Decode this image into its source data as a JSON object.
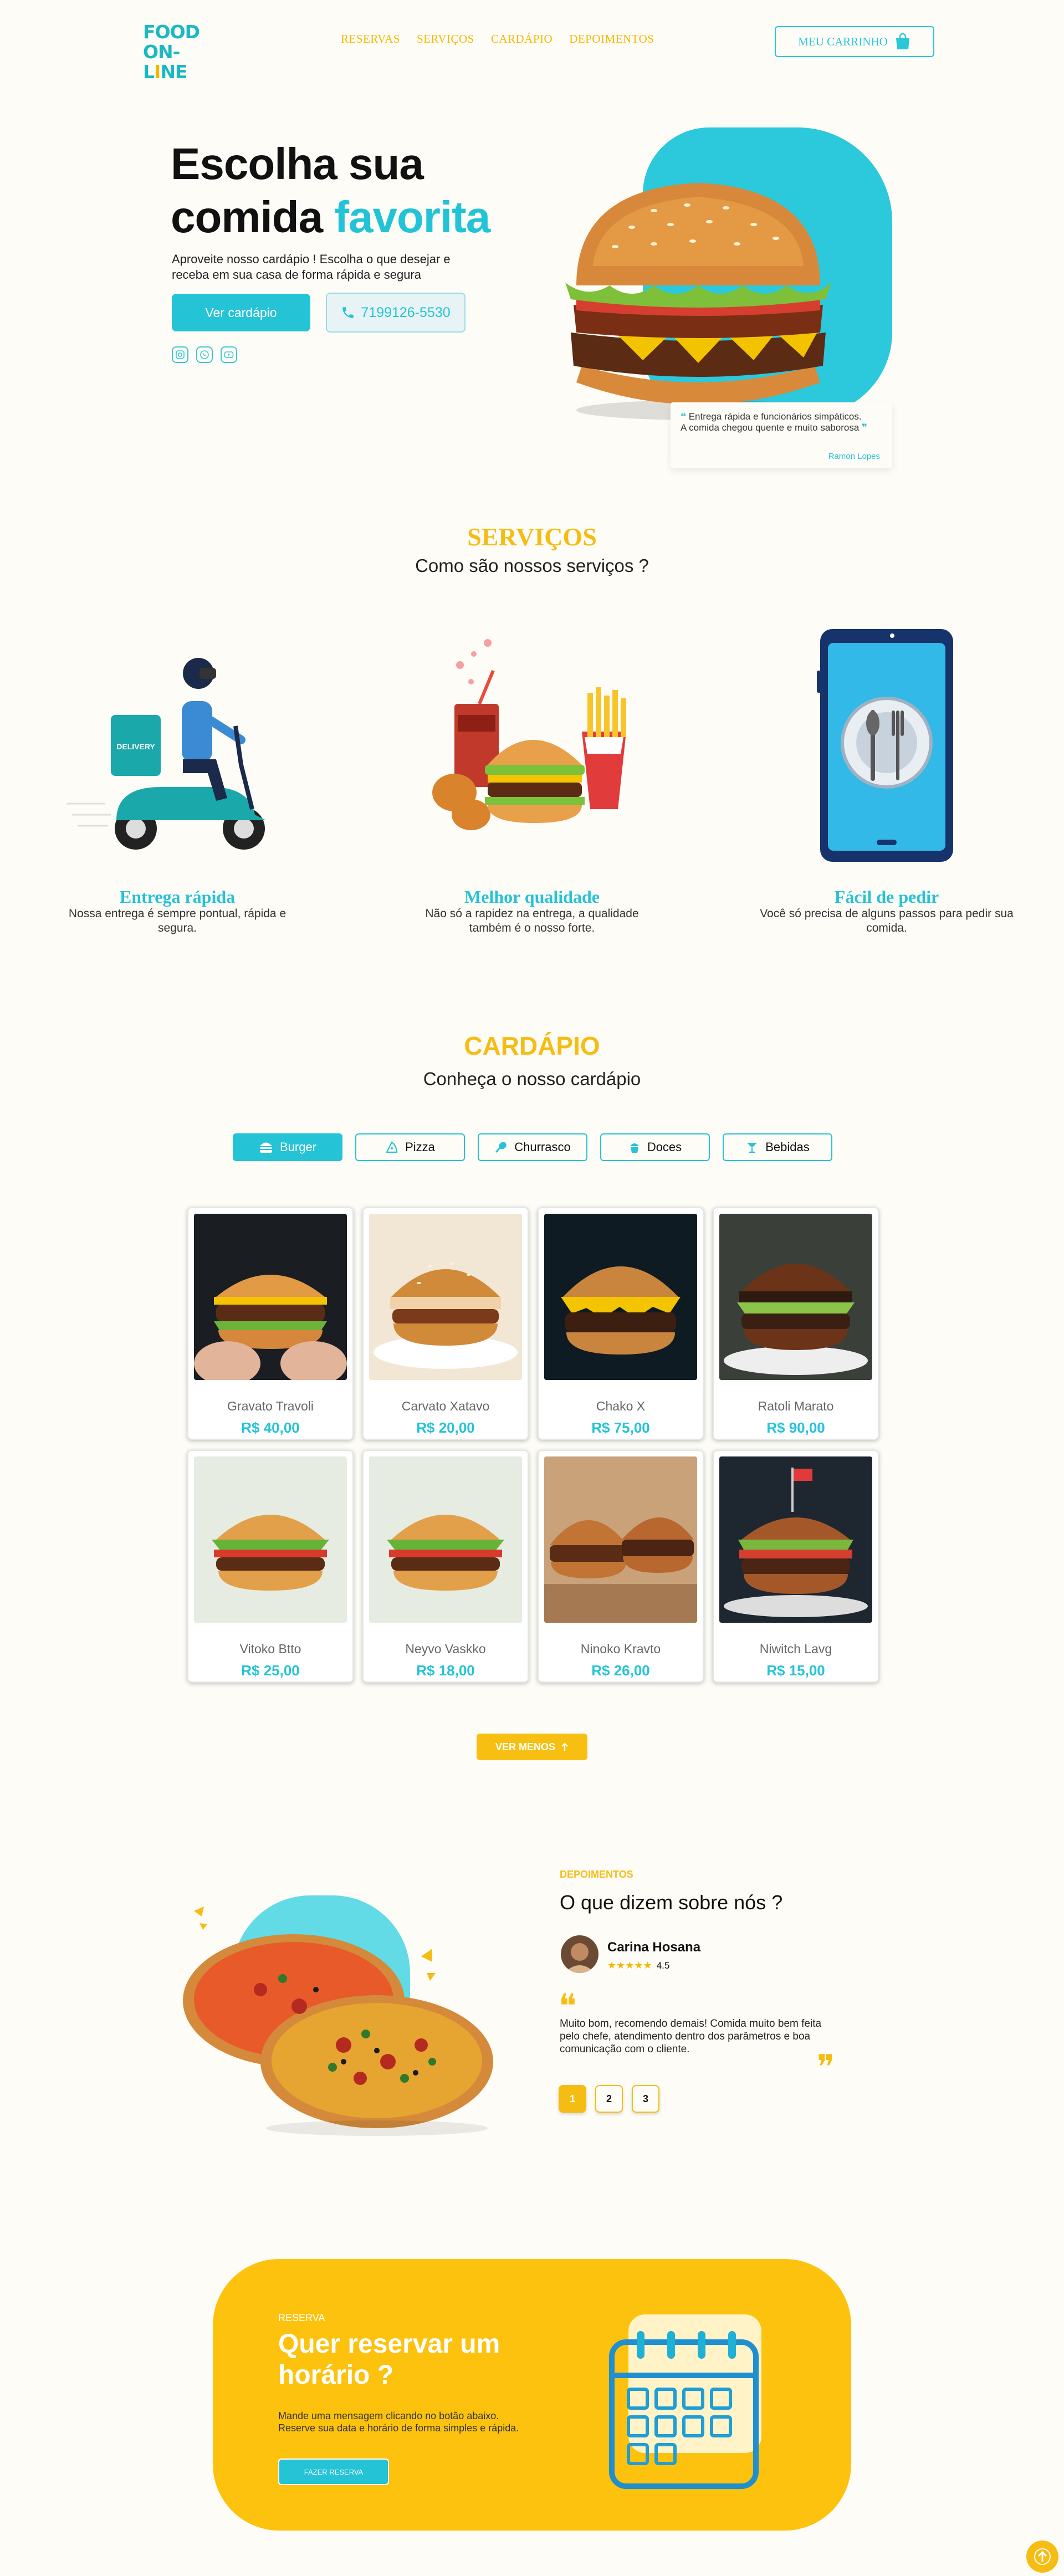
{
  "brand": {
    "logo_line1": "FOOD",
    "logo_line2a": "ON-L",
    "logo_line2b": "I",
    "logo_line2c": "NE"
  },
  "nav": {
    "items": [
      "RESERVAS",
      "SERVIÇOS",
      "CARDÁPIO",
      "DEPOIMENTOS"
    ]
  },
  "cart": {
    "label": "MEU CARRINHO",
    "icon": "shopping-bag-icon"
  },
  "hero": {
    "title_line1": "Escolha sua",
    "title_line2a": "comida",
    "title_line2b": "favorita",
    "description": "Aproveite nosso cardápio ! Escolha o que desejar e receba em sua casa de forma rápida e segura",
    "menu_button": "Ver cardápio",
    "phone": "7199126-5530",
    "socials": [
      "instagram-icon",
      "whatsapp-icon",
      "youtube-icon"
    ],
    "review_text": "Entrega rápida e funcionários simpáticos. A comida chegou quente e muito saborosa",
    "review_author": "Ramon Lopes"
  },
  "services": {
    "kicker": "SERVIÇOS",
    "title": "Como são nossos serviços ?",
    "items": [
      {
        "title": "Entrega rápida",
        "text": "Nossa entrega é sempre pontual, rápida e segura."
      },
      {
        "title": "Melhor qualidade",
        "text": "Não só a rapidez na entrega, a qualidade também é o nosso forte."
      },
      {
        "title": "Fácil de pedir",
        "text": "Você só precisa de alguns passos para pedir sua comida."
      }
    ]
  },
  "menu": {
    "kicker": "CARDÁPIO",
    "title": "Conheça o nosso cardápio",
    "tabs": [
      "Burger",
      "Pizza",
      "Churrasco",
      "Doces",
      "Bebidas"
    ],
    "active_tab": "Burger",
    "items": [
      {
        "name": "Gravato Travoli",
        "price": "R$ 40,00"
      },
      {
        "name": "Carvato Xatavo",
        "price": "R$ 20,00"
      },
      {
        "name": "Chako X",
        "price": "R$ 75,00"
      },
      {
        "name": "Ratoli Marato",
        "price": "R$ 90,00"
      },
      {
        "name": "Vitoko Btto",
        "price": "R$ 25,00"
      },
      {
        "name": "Neyvo Vaskko",
        "price": "R$ 18,00"
      },
      {
        "name": "Ninoko Kravto",
        "price": "R$ 26,00"
      },
      {
        "name": "Niwitch Lavg",
        "price": "R$ 15,00"
      }
    ],
    "less_button": "VER MENOS"
  },
  "testimonials": {
    "kicker": "DEPOIMENTOS",
    "title": "O que dizem sobre nós ?",
    "author": "Carina Hosana",
    "stars": "★★★★★",
    "rating": "4.5",
    "text": "Muito bom, recomendo demais! Comida muito bem feita pelo chefe, atendimento dentro dos parâmetros e boa comunicação com o cliente.",
    "pages": [
      "1",
      "2",
      "3"
    ],
    "active_page": "1"
  },
  "reservation": {
    "kicker": "RESERVA",
    "title_line1": "Quer reservar um",
    "title_line2": "horário ?",
    "text": "Mande uma mensagem clicando no botão abaixo. Reserve sua data e horário de forma simples e rápida.",
    "button": "FAZER RESERVA"
  },
  "colors": {
    "accent": "#25c3d6",
    "yellow": "#f5bd14",
    "background": "#fdfcf6"
  }
}
